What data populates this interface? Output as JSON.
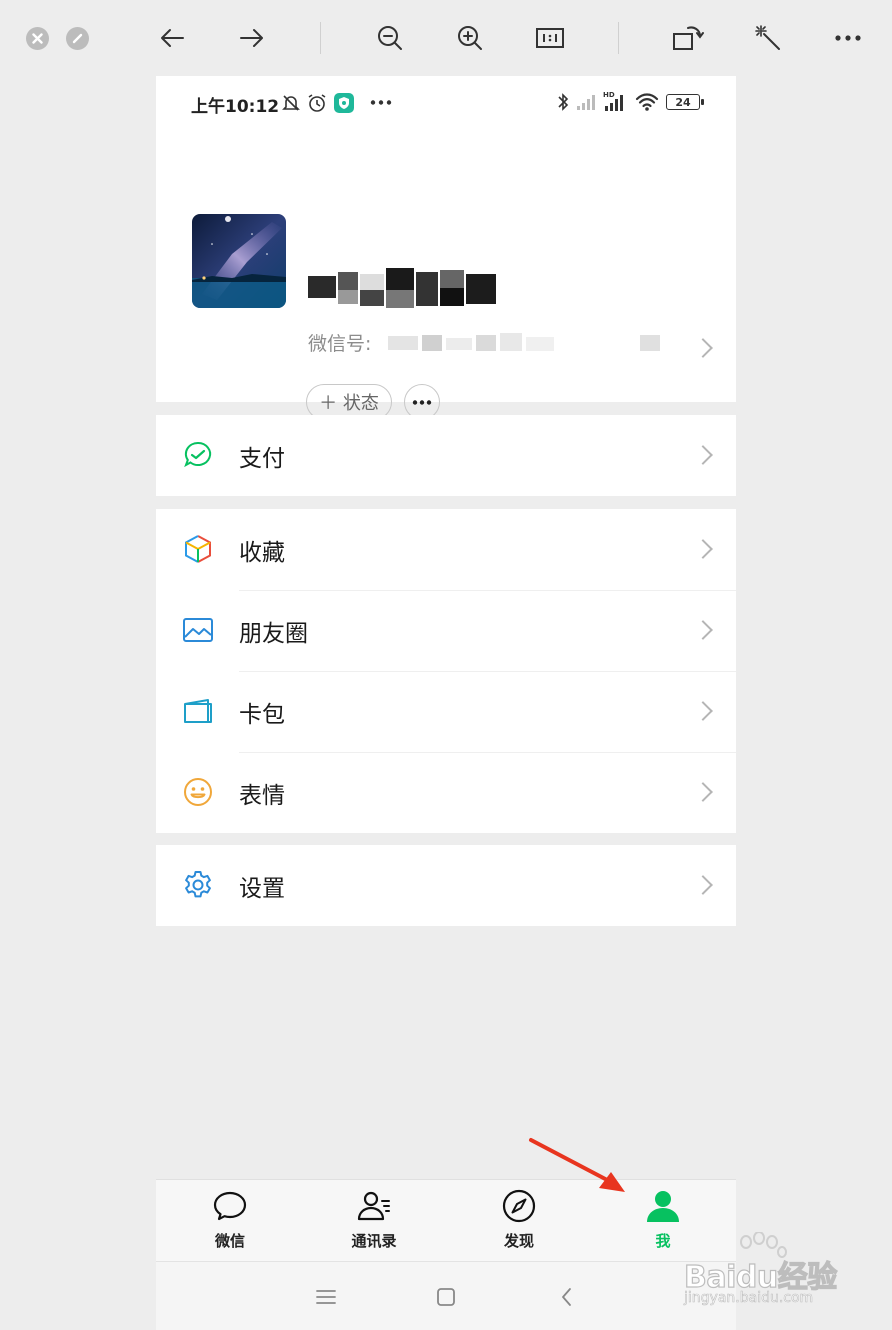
{
  "phone_status": {
    "time": "上午10:12",
    "battery": "24"
  },
  "profile": {
    "wechat_id_label": "微信号:",
    "status_button": "＋ 状态"
  },
  "menu": {
    "pay": "支付",
    "favorites": "收藏",
    "moments": "朋友圈",
    "cards": "卡包",
    "stickers": "表情",
    "settings": "设置"
  },
  "tabs": [
    {
      "label": "微信",
      "icon": "chat-bubble-icon"
    },
    {
      "label": "通讯录",
      "icon": "contacts-icon"
    },
    {
      "label": "发现",
      "icon": "compass-icon"
    },
    {
      "label": "我",
      "icon": "person-icon"
    }
  ],
  "active_tab": "我",
  "colors": {
    "accent": "#07c160",
    "arrow": "#e8351f"
  },
  "watermark": {
    "brand": "Baidu经验",
    "url": "jingyan.baidu.com"
  }
}
